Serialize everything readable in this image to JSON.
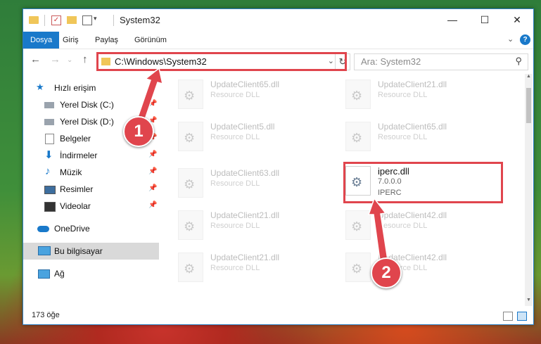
{
  "window": {
    "title": "System32"
  },
  "ribbon": {
    "tabs": [
      "Dosya",
      "Giriş",
      "Paylaş",
      "Görünüm"
    ],
    "help": "?"
  },
  "address": {
    "path": "C:\\Windows\\System32",
    "refresh": "↻",
    "dropdown": "⌄"
  },
  "search": {
    "placeholder": "Ara: System32"
  },
  "sidebar": {
    "items": [
      {
        "label": "Hızlı erişim"
      },
      {
        "label": "Yerel Disk (C:)"
      },
      {
        "label": "Yerel Disk (D:)"
      },
      {
        "label": "Belgeler"
      },
      {
        "label": "İndirmeler"
      },
      {
        "label": "Müzik"
      },
      {
        "label": "Resimler"
      },
      {
        "label": "Videolar"
      },
      {
        "label": "OneDrive"
      },
      {
        "label": "Bu bilgisayar"
      },
      {
        "label": "Ağ"
      }
    ]
  },
  "files": [
    {
      "name": "UpdateClient65.dll",
      "desc": "Resource DLL"
    },
    {
      "name": "UpdateClient21.dll",
      "desc": "Resource DLL"
    },
    {
      "name": "UpdateClient5.dll",
      "desc": "Resource DLL"
    },
    {
      "name": "UpdateClient65.dll",
      "desc": "Resource DLL"
    },
    {
      "name": "UpdateClient63.dll",
      "desc": "Resource DLL"
    },
    {
      "name": "iperc.dll",
      "version": "7.0.0.0",
      "company": "IPERC"
    },
    {
      "name": "UpdateClient21.dll",
      "desc": "Resource DLL"
    },
    {
      "name": "UpdateClient42.dll",
      "desc": "Resource DLL"
    },
    {
      "name": "UpdateClient21.dll",
      "desc": "Resource DLL"
    },
    {
      "name": "UpdateClient42.dll",
      "desc": "Resource DLL"
    }
  ],
  "status": {
    "count": "173 öğe"
  },
  "callouts": [
    "1",
    "2"
  ],
  "colors": {
    "accent": "#1979ca",
    "highlight": "#e0454d"
  }
}
